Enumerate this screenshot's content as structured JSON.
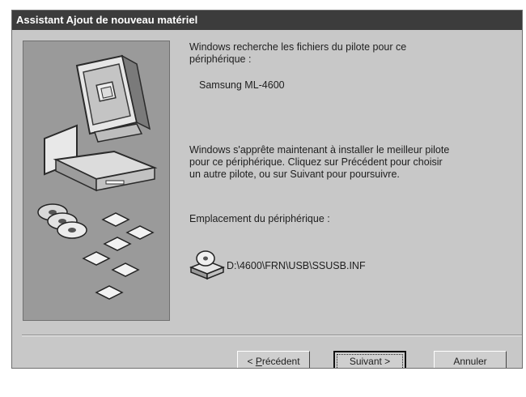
{
  "window": {
    "title": "Assistant Ajout de nouveau matériel"
  },
  "body": {
    "search_text": "Windows recherche les fichiers du pilote pour ce\npériphérique :",
    "device_name": "Samsung ML-4600",
    "ready_text": "Windows s'apprête maintenant à installer le meilleur pilote\npour ce périphérique. Cliquez sur Précédent pour choisir\nun autre pilote, ou sur Suivant pour poursuivre.",
    "location_label": "Emplacement du périphérique :",
    "location_path": "D:\\4600\\FRN\\USB\\SSUSB.INF",
    "location_icon": "disk-drive-icon"
  },
  "sidebar": {
    "illustration": "computer-with-cd-and-diskettes"
  },
  "buttons": {
    "back_prefix": "< ",
    "back_hotkey": "P",
    "back_rest": "récédent",
    "next_label": "Suivant >",
    "cancel_label": "Annuler"
  }
}
